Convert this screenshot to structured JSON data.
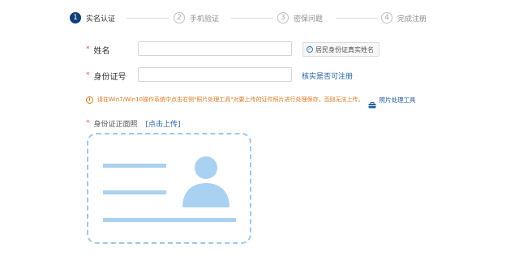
{
  "steps": [
    {
      "number": "1",
      "label": "实名认证",
      "active": true
    },
    {
      "number": "2",
      "label": "手机验证",
      "active": false
    },
    {
      "number": "3",
      "label": "密保问题",
      "active": false
    },
    {
      "number": "4",
      "label": "完成注册",
      "active": false
    }
  ],
  "form": {
    "name": {
      "required_mark": "*",
      "label": "姓名",
      "value": "",
      "hint": "居民身份证真实姓名"
    },
    "id_number": {
      "required_mark": "*",
      "label": "身份证号",
      "value": "",
      "verify_text": "核实是否可注册"
    }
  },
  "notice": {
    "text": "请在Win7/Win10操作系统中点击右侧\"照片处理工具\"对要上传的证件照片进行处理保存，否则无法上传。",
    "tool_label": "照片处理工具"
  },
  "upload": {
    "required_mark": "*",
    "label": "身份证正面照",
    "action_label": "[点击上传]"
  },
  "colors": {
    "accent": "#0f3f7a",
    "link": "#1f5fa8",
    "warning": "#e0781f",
    "required": "#e25a3a",
    "placeholder_graphic": "#a9d1f2"
  }
}
